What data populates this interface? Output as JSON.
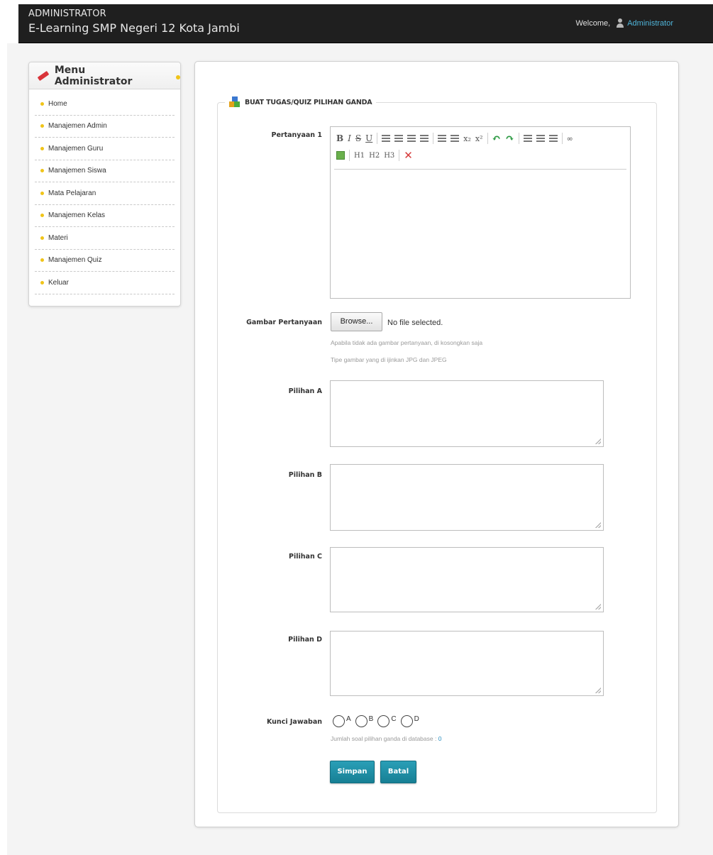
{
  "header": {
    "role": "ADMINISTRATOR",
    "school": "E-Learning SMP Negeri 12 Kota Jambi",
    "welcome": "Welcome,",
    "user": "Administrator"
  },
  "sidebar": {
    "title": "Menu Administrator",
    "items": [
      {
        "label": "Home"
      },
      {
        "label": "Manajemen Admin"
      },
      {
        "label": "Manajemen Guru"
      },
      {
        "label": "Manajemen Siswa"
      },
      {
        "label": "Mata Pelajaran"
      },
      {
        "label": "Manajemen Kelas"
      },
      {
        "label": "Materi"
      },
      {
        "label": "Manajemen Quiz"
      },
      {
        "label": "Keluar"
      }
    ]
  },
  "form": {
    "legend": "BUAT TUGAS/QUIZ PILIHAN GANDA",
    "question_label": "Pertanyaan 1",
    "editor_toolbar": {
      "bold": "B",
      "italic": "I",
      "strike": "S",
      "underline": "U",
      "subscript": "x₂",
      "superscript": "x²",
      "h1": "H1",
      "h2": "H2",
      "h3": "H3",
      "remove": "✕",
      "link": "∞"
    },
    "image_label": "Gambar Pertanyaan",
    "browse_label": "Browse...",
    "no_file": "No file selected.",
    "hint1": "Apabila tidak ada gambar pertanyaan, di kosongkan saja",
    "hint2": "Tipe gambar yang di ijinkan JPG dan JPEG",
    "choice_a_label": "Pilihan A",
    "choice_b_label": "Pilihan B",
    "choice_c_label": "Pilihan C",
    "choice_d_label": "Pilihan D",
    "key_label": "Kunci Jawaban",
    "options": [
      "A",
      "B",
      "C",
      "D"
    ],
    "count_text": "Jumlah soal pilihan ganda di database : ",
    "count_value": "0",
    "save": "Simpan",
    "cancel": "Batal"
  }
}
